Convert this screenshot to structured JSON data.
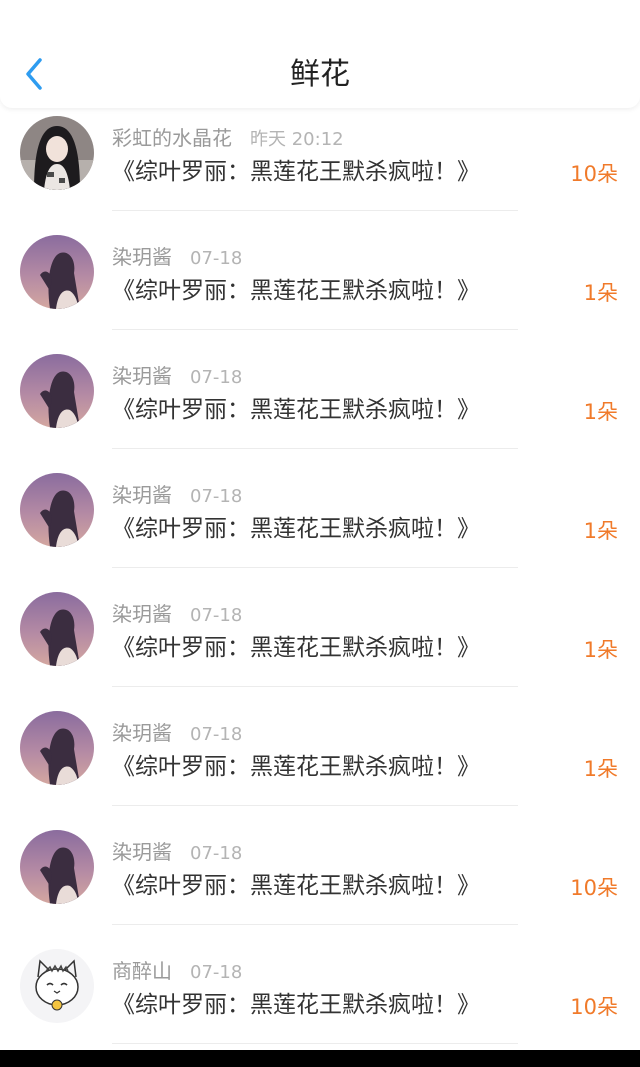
{
  "header": {
    "title": "鲜花",
    "back_icon": "chevron-left-icon",
    "accent_color": "#2e9cf0"
  },
  "colors": {
    "count": "#f07a2a",
    "username": "#9a9a9a",
    "time": "#b4b4b4"
  },
  "rows": [
    {
      "user": "彩虹的水晶花",
      "time": "昨天 20:12",
      "book": "《综叶罗丽：黑莲花王默杀疯啦！》",
      "count": "10朵",
      "avatar": "avatar-girl-long-hair"
    },
    {
      "user": "染玥酱",
      "time": "07-18",
      "book": "《综叶罗丽：黑莲花王默杀疯啦！》",
      "count": "1朵",
      "avatar": "avatar-sunset-silhouette"
    },
    {
      "user": "染玥酱",
      "time": "07-18",
      "book": "《综叶罗丽：黑莲花王默杀疯啦！》",
      "count": "1朵",
      "avatar": "avatar-sunset-silhouette"
    },
    {
      "user": "染玥酱",
      "time": "07-18",
      "book": "《综叶罗丽：黑莲花王默杀疯啦！》",
      "count": "1朵",
      "avatar": "avatar-sunset-silhouette"
    },
    {
      "user": "染玥酱",
      "time": "07-18",
      "book": "《综叶罗丽：黑莲花王默杀疯啦！》",
      "count": "1朵",
      "avatar": "avatar-sunset-silhouette"
    },
    {
      "user": "染玥酱",
      "time": "07-18",
      "book": "《综叶罗丽：黑莲花王默杀疯啦！》",
      "count": "1朵",
      "avatar": "avatar-sunset-silhouette"
    },
    {
      "user": "染玥酱",
      "time": "07-18",
      "book": "《综叶罗丽：黑莲花王默杀疯啦！》",
      "count": "10朵",
      "avatar": "avatar-sunset-silhouette"
    },
    {
      "user": "商醉山",
      "time": "07-18",
      "book": "《综叶罗丽：黑莲花王默杀疯啦！》",
      "count": "10朵",
      "avatar": "avatar-cat-drawing"
    }
  ]
}
